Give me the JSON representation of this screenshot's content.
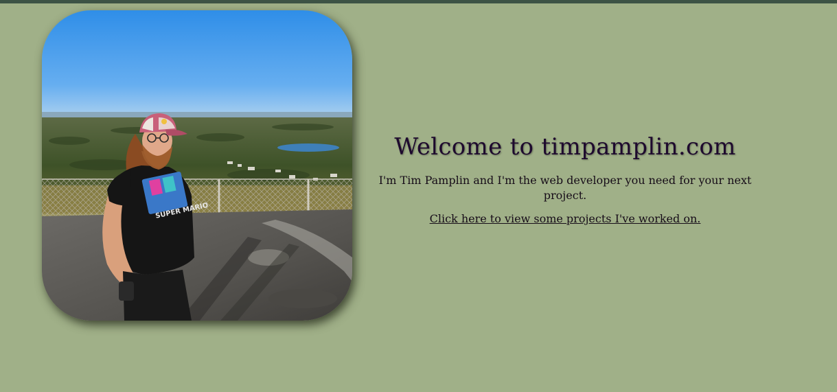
{
  "header": {
    "bar_color": "#3d5345"
  },
  "page": {
    "background_color": "#a0b088",
    "text_color": "#1e0a2e"
  },
  "profile_photo": {
    "shirt_text": "SUPER MARIO"
  },
  "hero": {
    "title": "Welcome to timpamplin.com",
    "intro": "I'm Tim Pamplin and I'm the web developer you need for your next project.",
    "projects_link": "Click here to view some projects I've worked on."
  }
}
